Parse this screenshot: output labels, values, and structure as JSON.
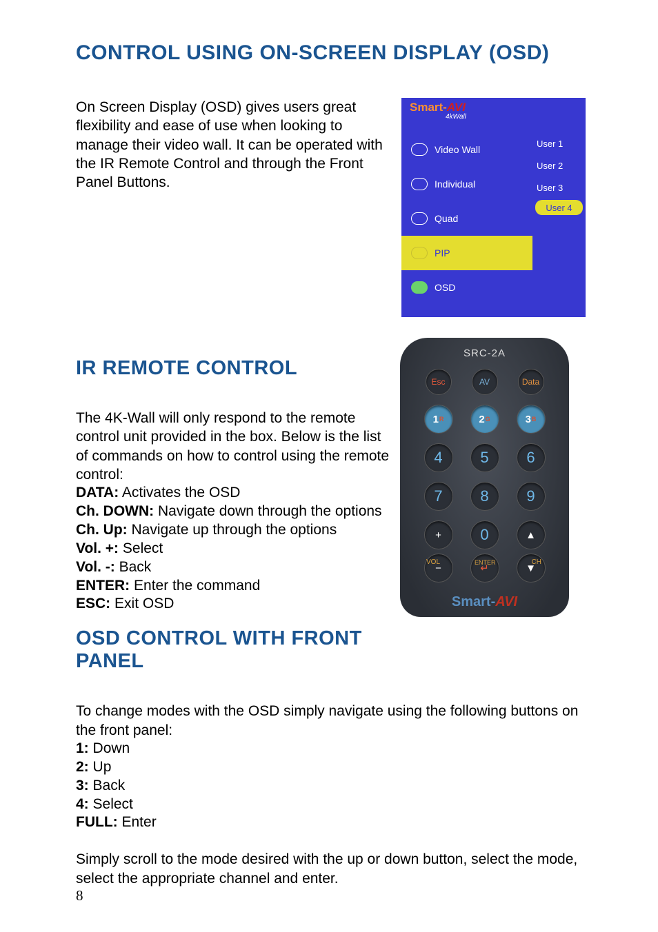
{
  "page_number": "8",
  "section1": {
    "title": "CONTROL USING ON-SCREEN DISPLAY (OSD)",
    "paragraph": "On Screen Display (OSD) gives users great flexibility and ease of use when looking to manage their video wall. It  can be operated with the IR Remote Control and through the Front Panel Buttons."
  },
  "osd_menu": {
    "brand_prefix": "Smart-",
    "brand_suffix": "AVI",
    "brand_sub": "4kWall",
    "items": [
      {
        "label": "Video Wall",
        "selected": false
      },
      {
        "label": "Individual",
        "selected": false
      },
      {
        "label": "Quad",
        "selected": false
      },
      {
        "label": "PIP",
        "selected": true
      },
      {
        "label": "OSD",
        "selected": false
      }
    ],
    "users": [
      {
        "label": "User 1",
        "selected": false
      },
      {
        "label": "User 2",
        "selected": false
      },
      {
        "label": "User 3",
        "selected": false
      },
      {
        "label": "User 4",
        "selected": true
      }
    ]
  },
  "section2": {
    "title": "IR REMOTE CONTROL",
    "intro": "The 4K-Wall will only respond to the remote control unit provided in the box. Below is the list of commands on how to control using the remote control:",
    "defs": [
      {
        "term": "DATA:",
        "desc": " Activates the OSD"
      },
      {
        "term": "Ch. DOWN:",
        "desc": " Navigate down through the options"
      },
      {
        "term": "Ch. Up:",
        "desc": " Navigate up through the options"
      },
      {
        "term": "Vol. +:",
        "desc": " Select"
      },
      {
        "term": "Vol. -:",
        "desc": " Back"
      },
      {
        "term": "ENTER:",
        "desc": " Enter the command"
      },
      {
        "term": "ESC:",
        "desc": " Exit OSD"
      }
    ]
  },
  "remote": {
    "model": "SRC-2A",
    "top_row": {
      "esc": "Esc",
      "av": "AV",
      "data": "Data"
    },
    "num_row1": {
      "n1": "1",
      "n1s": "R",
      "n2": "2",
      "n2s": "G",
      "n3": "3",
      "n3s": "B"
    },
    "num_row2": {
      "n4": "4",
      "n5": "5",
      "n6": "6"
    },
    "num_row3": {
      "n7": "7",
      "n8": "8",
      "n9": "9"
    },
    "bottom_row1": {
      "plus": "+",
      "zero": "0",
      "up": "▲"
    },
    "bottom_row2": {
      "minus": "−",
      "enter": "↵",
      "down": "▼"
    },
    "labels": {
      "vol": "VOL",
      "enter": "ENTER",
      "ch": "CH"
    },
    "brand_prefix": "Smart-",
    "brand_suffix": "AVI"
  },
  "section3": {
    "title": "OSD CONTROL WITH FRONT PANEL",
    "intro": "To change modes with the OSD simply navigate using the following buttons on the front panel:",
    "defs": [
      {
        "term": "1:",
        "desc": "  Down"
      },
      {
        "term": "2:",
        "desc": " Up"
      },
      {
        "term": "3:",
        "desc": " Back"
      },
      {
        "term": "4:",
        "desc": " Select"
      },
      {
        "term": "FULL:",
        "desc": " Enter"
      }
    ],
    "outro": "Simply scroll to the mode desired with the up or down button, select the mode, select the appropriate channel and enter."
  }
}
